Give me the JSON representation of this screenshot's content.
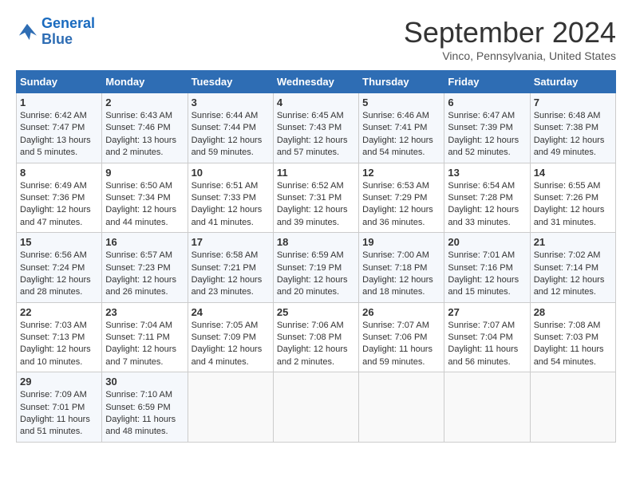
{
  "header": {
    "logo_line1": "General",
    "logo_line2": "Blue",
    "month_title": "September 2024",
    "subtitle": "Vinco, Pennsylvania, United States"
  },
  "days_of_week": [
    "Sunday",
    "Monday",
    "Tuesday",
    "Wednesday",
    "Thursday",
    "Friday",
    "Saturday"
  ],
  "weeks": [
    [
      {
        "day": "1",
        "sunrise": "6:42 AM",
        "sunset": "7:47 PM",
        "daylight": "13 hours and 5 minutes."
      },
      {
        "day": "2",
        "sunrise": "6:43 AM",
        "sunset": "7:46 PM",
        "daylight": "13 hours and 2 minutes."
      },
      {
        "day": "3",
        "sunrise": "6:44 AM",
        "sunset": "7:44 PM",
        "daylight": "12 hours and 59 minutes."
      },
      {
        "day": "4",
        "sunrise": "6:45 AM",
        "sunset": "7:43 PM",
        "daylight": "12 hours and 57 minutes."
      },
      {
        "day": "5",
        "sunrise": "6:46 AM",
        "sunset": "7:41 PM",
        "daylight": "12 hours and 54 minutes."
      },
      {
        "day": "6",
        "sunrise": "6:47 AM",
        "sunset": "7:39 PM",
        "daylight": "12 hours and 52 minutes."
      },
      {
        "day": "7",
        "sunrise": "6:48 AM",
        "sunset": "7:38 PM",
        "daylight": "12 hours and 49 minutes."
      }
    ],
    [
      {
        "day": "8",
        "sunrise": "6:49 AM",
        "sunset": "7:36 PM",
        "daylight": "12 hours and 47 minutes."
      },
      {
        "day": "9",
        "sunrise": "6:50 AM",
        "sunset": "7:34 PM",
        "daylight": "12 hours and 44 minutes."
      },
      {
        "day": "10",
        "sunrise": "6:51 AM",
        "sunset": "7:33 PM",
        "daylight": "12 hours and 41 minutes."
      },
      {
        "day": "11",
        "sunrise": "6:52 AM",
        "sunset": "7:31 PM",
        "daylight": "12 hours and 39 minutes."
      },
      {
        "day": "12",
        "sunrise": "6:53 AM",
        "sunset": "7:29 PM",
        "daylight": "12 hours and 36 minutes."
      },
      {
        "day": "13",
        "sunrise": "6:54 AM",
        "sunset": "7:28 PM",
        "daylight": "12 hours and 33 minutes."
      },
      {
        "day": "14",
        "sunrise": "6:55 AM",
        "sunset": "7:26 PM",
        "daylight": "12 hours and 31 minutes."
      }
    ],
    [
      {
        "day": "15",
        "sunrise": "6:56 AM",
        "sunset": "7:24 PM",
        "daylight": "12 hours and 28 minutes."
      },
      {
        "day": "16",
        "sunrise": "6:57 AM",
        "sunset": "7:23 PM",
        "daylight": "12 hours and 26 minutes."
      },
      {
        "day": "17",
        "sunrise": "6:58 AM",
        "sunset": "7:21 PM",
        "daylight": "12 hours and 23 minutes."
      },
      {
        "day": "18",
        "sunrise": "6:59 AM",
        "sunset": "7:19 PM",
        "daylight": "12 hours and 20 minutes."
      },
      {
        "day": "19",
        "sunrise": "7:00 AM",
        "sunset": "7:18 PM",
        "daylight": "12 hours and 18 minutes."
      },
      {
        "day": "20",
        "sunrise": "7:01 AM",
        "sunset": "7:16 PM",
        "daylight": "12 hours and 15 minutes."
      },
      {
        "day": "21",
        "sunrise": "7:02 AM",
        "sunset": "7:14 PM",
        "daylight": "12 hours and 12 minutes."
      }
    ],
    [
      {
        "day": "22",
        "sunrise": "7:03 AM",
        "sunset": "7:13 PM",
        "daylight": "12 hours and 10 minutes."
      },
      {
        "day": "23",
        "sunrise": "7:04 AM",
        "sunset": "7:11 PM",
        "daylight": "12 hours and 7 minutes."
      },
      {
        "day": "24",
        "sunrise": "7:05 AM",
        "sunset": "7:09 PM",
        "daylight": "12 hours and 4 minutes."
      },
      {
        "day": "25",
        "sunrise": "7:06 AM",
        "sunset": "7:08 PM",
        "daylight": "12 hours and 2 minutes."
      },
      {
        "day": "26",
        "sunrise": "7:07 AM",
        "sunset": "7:06 PM",
        "daylight": "11 hours and 59 minutes."
      },
      {
        "day": "27",
        "sunrise": "7:07 AM",
        "sunset": "7:04 PM",
        "daylight": "11 hours and 56 minutes."
      },
      {
        "day": "28",
        "sunrise": "7:08 AM",
        "sunset": "7:03 PM",
        "daylight": "11 hours and 54 minutes."
      }
    ],
    [
      {
        "day": "29",
        "sunrise": "7:09 AM",
        "sunset": "7:01 PM",
        "daylight": "11 hours and 51 minutes."
      },
      {
        "day": "30",
        "sunrise": "7:10 AM",
        "sunset": "6:59 PM",
        "daylight": "11 hours and 48 minutes."
      },
      null,
      null,
      null,
      null,
      null
    ]
  ]
}
